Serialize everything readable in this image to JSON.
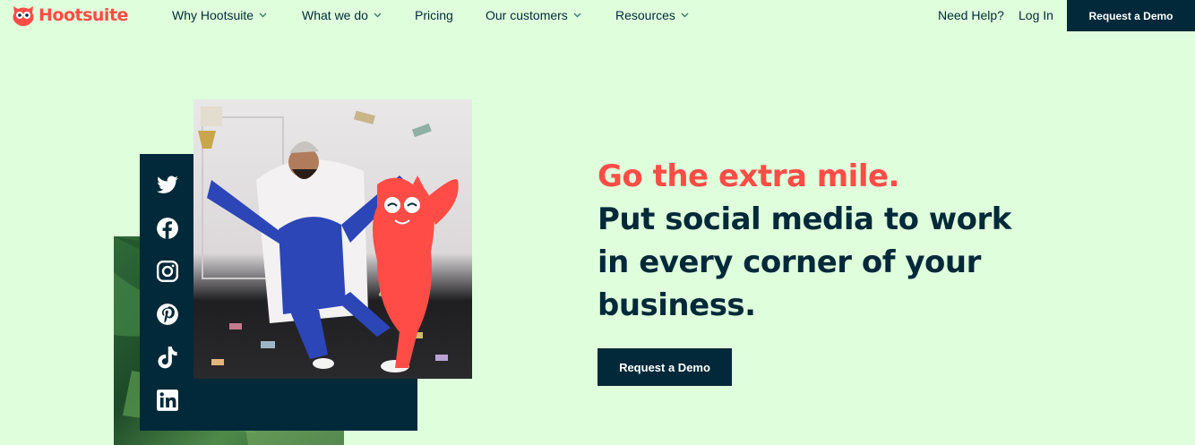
{
  "brand": {
    "name": "Hootsuite",
    "accent": "#ff4c46",
    "dark": "#012939",
    "background": "#dfffdc"
  },
  "nav": {
    "items": [
      {
        "label": "Why Hootsuite",
        "dropdown": true
      },
      {
        "label": "What we do",
        "dropdown": true
      },
      {
        "label": "Pricing",
        "dropdown": false
      },
      {
        "label": "Our customers",
        "dropdown": true
      },
      {
        "label": "Resources",
        "dropdown": true
      }
    ],
    "help": "Need Help?",
    "login": "Log In",
    "cta": "Request a Demo"
  },
  "hero": {
    "accent_line": "Go the extra mile.",
    "lines": [
      "Put social media to work",
      "in every corner of your",
      "business."
    ],
    "cta": "Request a Demo",
    "social_icons": [
      "twitter-icon",
      "facebook-icon",
      "instagram-icon",
      "pinterest-icon",
      "tiktok-icon",
      "linkedin-icon"
    ]
  }
}
